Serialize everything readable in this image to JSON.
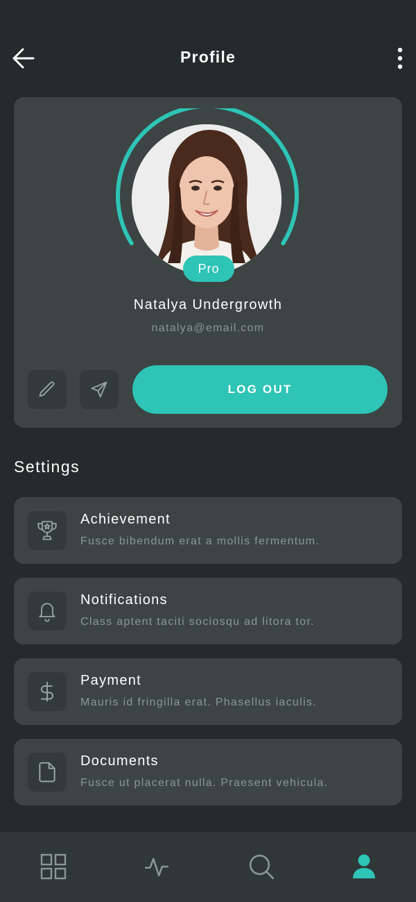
{
  "header": {
    "title": "Profile",
    "back_icon": "arrow-left-icon",
    "menu_icon": "more-vertical-icon"
  },
  "profile": {
    "name": "Natalya Undergrowth",
    "email": "natalya@email.com",
    "badge": "Pro",
    "actions": {
      "edit_icon": "pencil-icon",
      "share_icon": "send-icon",
      "logout_label": "LOG OUT"
    }
  },
  "settings": {
    "title": "Settings",
    "items": [
      {
        "title": "Achievement",
        "description": "Fusce bibendum erat a mollis fermentum.",
        "icon": "trophy-icon"
      },
      {
        "title": "Notifications",
        "description": "Class aptent taciti sociosqu ad litora tor.",
        "icon": "bell-icon"
      },
      {
        "title": "Payment",
        "description": "Mauris id fringilla erat. Phasellus iaculis.",
        "icon": "dollar-icon"
      },
      {
        "title": "Documents",
        "description": "Fusce ut placerat nulla. Praesent vehicula.",
        "icon": "document-icon"
      }
    ]
  },
  "bottom_nav": {
    "items": [
      {
        "icon": "grid-icon",
        "active": false
      },
      {
        "icon": "activity-icon",
        "active": false
      },
      {
        "icon": "search-icon",
        "active": false
      },
      {
        "icon": "user-icon",
        "active": true
      }
    ]
  },
  "colors": {
    "background": "#232b2b",
    "card": "#3c4444",
    "icon_tile": "#323a3a",
    "accent": "#2ec4b6",
    "muted_text": "#8d9696",
    "nav_bar": "#2f3737"
  }
}
